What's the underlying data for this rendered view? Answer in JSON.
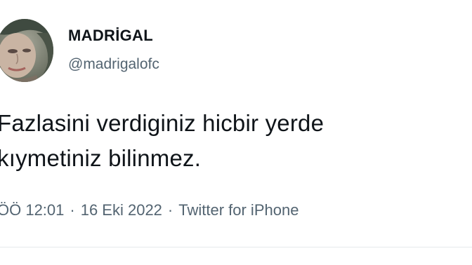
{
  "tweet": {
    "display_name": "MADRİGAL",
    "handle": "@madrigalofc",
    "text_lines": [
      "Fazlasini verdiginiz hicbir yerde",
      "kıymetiniz bilinmez."
    ],
    "time": "ÖÖ 12:01",
    "separator": "·",
    "date": "16 Eki 2022",
    "source": "Twitter for iPhone"
  },
  "colors": {
    "text_primary": "#0f1419",
    "text_secondary": "#536471",
    "background": "#ffffff"
  },
  "icons": {
    "avatar": "profile-photo"
  }
}
